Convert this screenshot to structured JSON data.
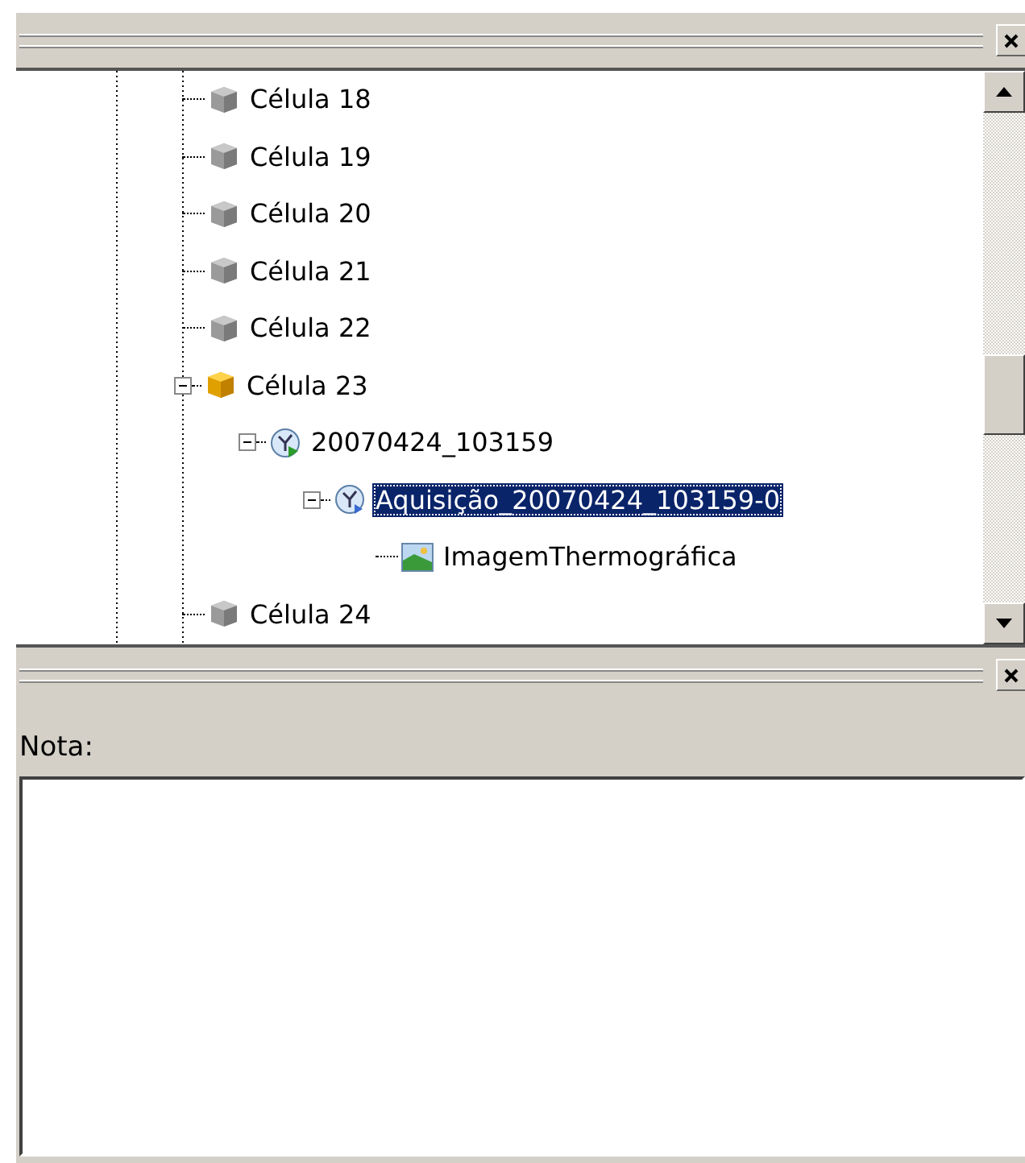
{
  "tree": {
    "items": [
      {
        "label": "Célula 18",
        "kind": "cell",
        "selected": false
      },
      {
        "label": "Célula 19",
        "kind": "cell",
        "selected": false
      },
      {
        "label": "Célula 20",
        "kind": "cell",
        "selected": false
      },
      {
        "label": "Célula 21",
        "kind": "cell",
        "selected": false
      },
      {
        "label": "Célula 22",
        "kind": "cell",
        "selected": false
      },
      {
        "label": "Célula 23",
        "kind": "active-cell",
        "selected": false,
        "expanded": true,
        "children": [
          {
            "label": "20070424_103159",
            "kind": "session",
            "selected": false,
            "expanded": true,
            "children": [
              {
                "label": "Aquisição_20070424_103159-0",
                "kind": "acquisition",
                "selected": true,
                "expanded": true,
                "children": [
                  {
                    "label": "ImagemThermográfica",
                    "kind": "image",
                    "selected": false
                  }
                ]
              }
            ]
          }
        ]
      },
      {
        "label": "Célula 24",
        "kind": "cell",
        "selected": false
      }
    ]
  },
  "note_panel": {
    "label": "Nota:"
  }
}
